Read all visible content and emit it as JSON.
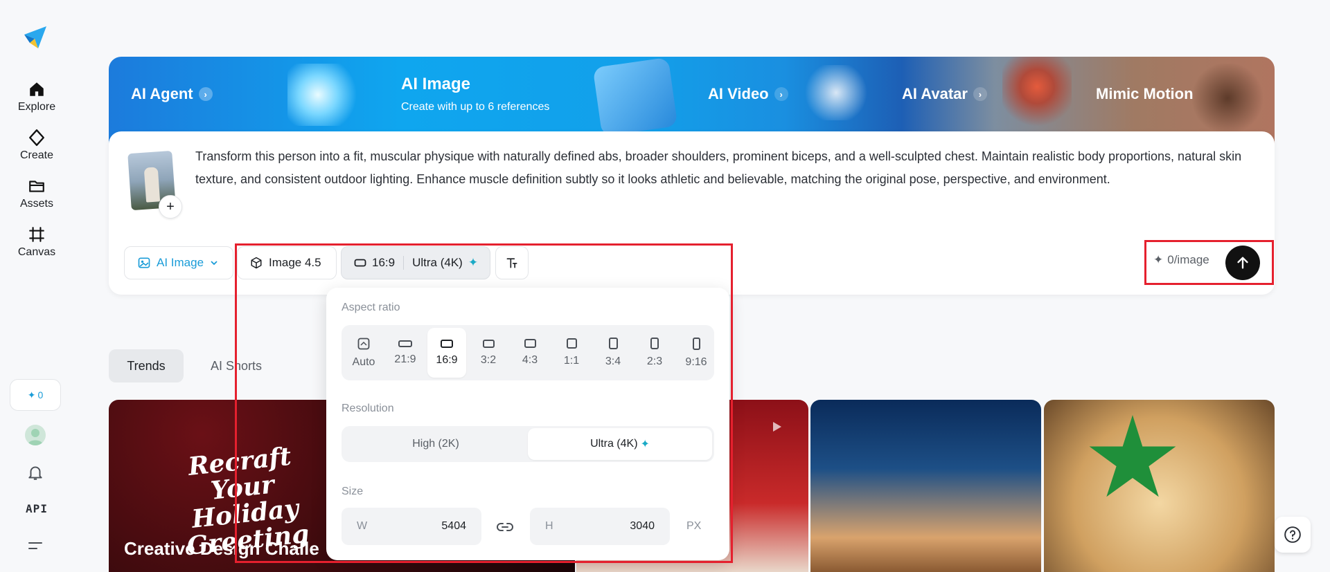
{
  "sidebar": {
    "nav": [
      {
        "label": "Explore",
        "icon": "home-icon"
      },
      {
        "label": "Create",
        "icon": "diamond-icon"
      },
      {
        "label": "Assets",
        "icon": "folder-icon"
      },
      {
        "label": "Canvas",
        "icon": "canvas-icon"
      }
    ],
    "credits": "0",
    "api_label": "API"
  },
  "banner": {
    "tabs": [
      {
        "label": "AI Agent"
      },
      {
        "label": "AI Image",
        "subtitle": "Create with up to 6 references"
      },
      {
        "label": "AI Video"
      },
      {
        "label": "AI Avatar"
      },
      {
        "label": "Mimic Motion"
      }
    ]
  },
  "prompt": {
    "text": "Transform this person into a fit, muscular physique with naturally defined abs, broader shoulders, prominent biceps, and a well-sculpted chest. Maintain realistic body proportions, natural skin texture, and consistent outdoor lighting. Enhance muscle definition subtly so it looks athletic and believable, matching the original pose, perspective, and environment.",
    "add_symbol": "+"
  },
  "toolbar": {
    "mode_label": "AI Image",
    "model_label": "Image 4.5",
    "aspect_label": "16:9",
    "resolution_label": "Ultra (4K)",
    "cost_label": "0/image"
  },
  "popover": {
    "aspect_title": "Aspect ratio",
    "aspect_options": [
      "Auto",
      "21:9",
      "16:9",
      "3:2",
      "4:3",
      "1:1",
      "3:4",
      "2:3",
      "9:16"
    ],
    "aspect_selected": "16:9",
    "resolution_title": "Resolution",
    "resolution_options": [
      "High (2K)",
      "Ultra (4K)"
    ],
    "resolution_selected": "Ultra (4K)",
    "size_title": "Size",
    "width_label": "W",
    "width_value": "5404",
    "height_label": "H",
    "height_value": "3040",
    "unit": "PX"
  },
  "trends": {
    "tabs": [
      "Trends",
      "AI Shorts"
    ],
    "selected": "Trends"
  },
  "gallery": {
    "card1_title": "Recraft Your Holiday Greeting",
    "card1_caption": "Creative Design Challe"
  },
  "colors": {
    "accent": "#1a9cd8",
    "highlight": "#e5202e",
    "send": "#111111"
  }
}
